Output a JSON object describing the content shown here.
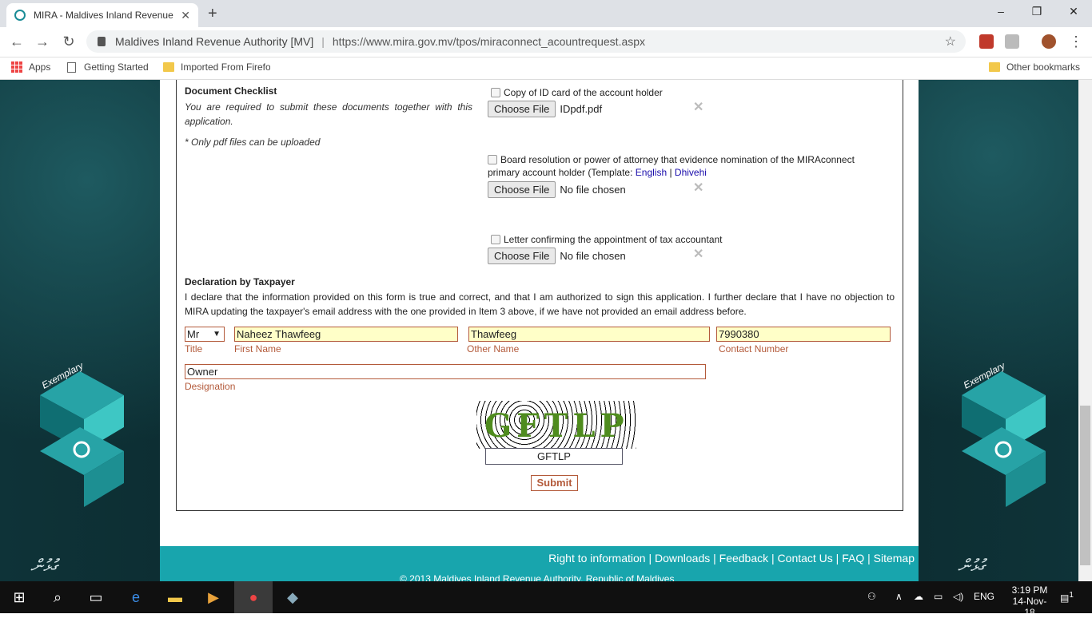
{
  "browser": {
    "tab_title": "MIRA - Maldives Inland Revenue",
    "new_tab": "+",
    "minimize": "–",
    "maximize": "❐",
    "close": "✕",
    "site_name": "Maldives Inland Revenue Authority [MV]",
    "url": "https://www.mira.gov.mv/tpos/miraconnect_acountrequest.aspx",
    "bookmarks": [
      "Apps",
      "Getting Started",
      "Imported From Firefo",
      "Other bookmarks"
    ]
  },
  "form": {
    "checklist_title": "Document Checklist",
    "checklist_desc": "You are required to submit these documents together with this application.",
    "pdf_note": "* Only pdf files can be uploaded",
    "doc1_label": "Copy of ID card of the account holder",
    "doc1_file": "IDpdf.pdf",
    "doc2_label": "Board resolution or power of attorney that evidence nomination of the MIRAconnect primary account holder (Template:",
    "doc2_english": "English",
    "doc2_dhivehi": "Dhivehi",
    "doc2_file": "No file chosen",
    "doc3_label": "Letter confirming the appointment of tax accountant",
    "doc3_file": "No file chosen",
    "choose_file": "Choose File",
    "declaration_title": "Declaration by Taxpayer",
    "declaration_text": "I declare that the information provided on this form is true and correct, and that I am authorized to sign this application. I further declare that I have no objection to MIRA updating the taxpayer's email address with the one provided in Item 3 above, if we have not provided an email address before.",
    "title_value": "Mr",
    "title_label": "Title",
    "first_name_value": "Naheez Thawfeeg",
    "first_name_label": "First Name",
    "other_name_value": "Thawfeeg",
    "other_name_label": "Other Name",
    "contact_value": "7990380",
    "contact_label": "Contact Number",
    "designation_value": "Owner",
    "designation_label": "Designation",
    "captcha_image_text": "GFTLP",
    "captcha_input": "GFTLP",
    "submit": "Submit"
  },
  "footer": {
    "links": "Right to information | Downloads | Feedback | Contact Us | FAQ | Sitemap",
    "copyright": "© 2013 Maldives Inland Revenue Authority, Republic of Maldives"
  },
  "logo_text": "Exemplary",
  "taskbar": {
    "lang": "ENG",
    "time": "3:19 PM",
    "date": "14-Nov-18",
    "notifications": "1"
  },
  "colors": {
    "accent": "#18a5ad",
    "label": "#b35a3a",
    "input_bg": "#ffffc8"
  }
}
